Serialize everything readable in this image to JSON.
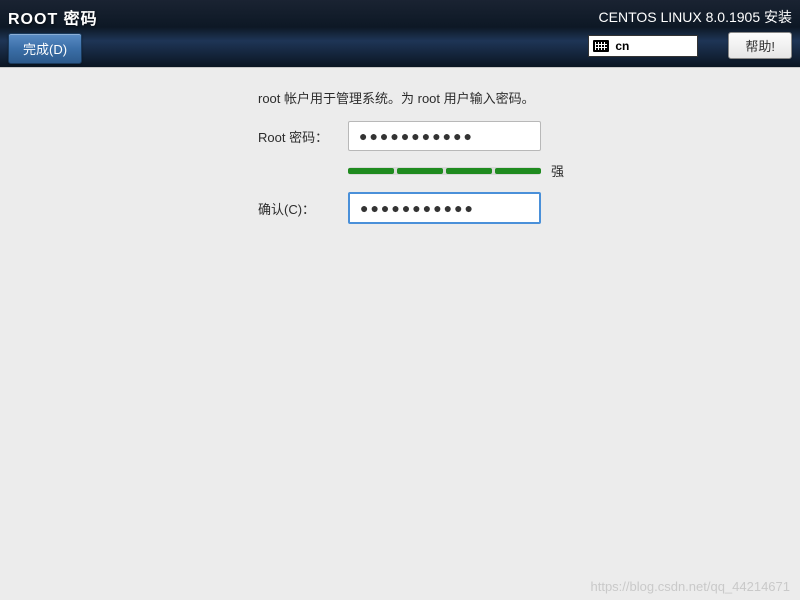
{
  "header": {
    "page_title": "ROOT 密码",
    "done_button": "完成(D)",
    "install_title": "CENTOS LINUX 8.0.1905 安装",
    "keyboard_layout": "cn",
    "help_button": "帮助!"
  },
  "content": {
    "description": "root 帐户用于管理系统。为 root 用户输入密码。",
    "password_label": "Root 密码：",
    "password_value": "●●●●●●●●●●●",
    "confirm_label": "确认(C)：",
    "confirm_value": "●●●●●●●●●●●",
    "strength_label": "强"
  },
  "watermark": "https://blog.csdn.net/qq_44214671"
}
